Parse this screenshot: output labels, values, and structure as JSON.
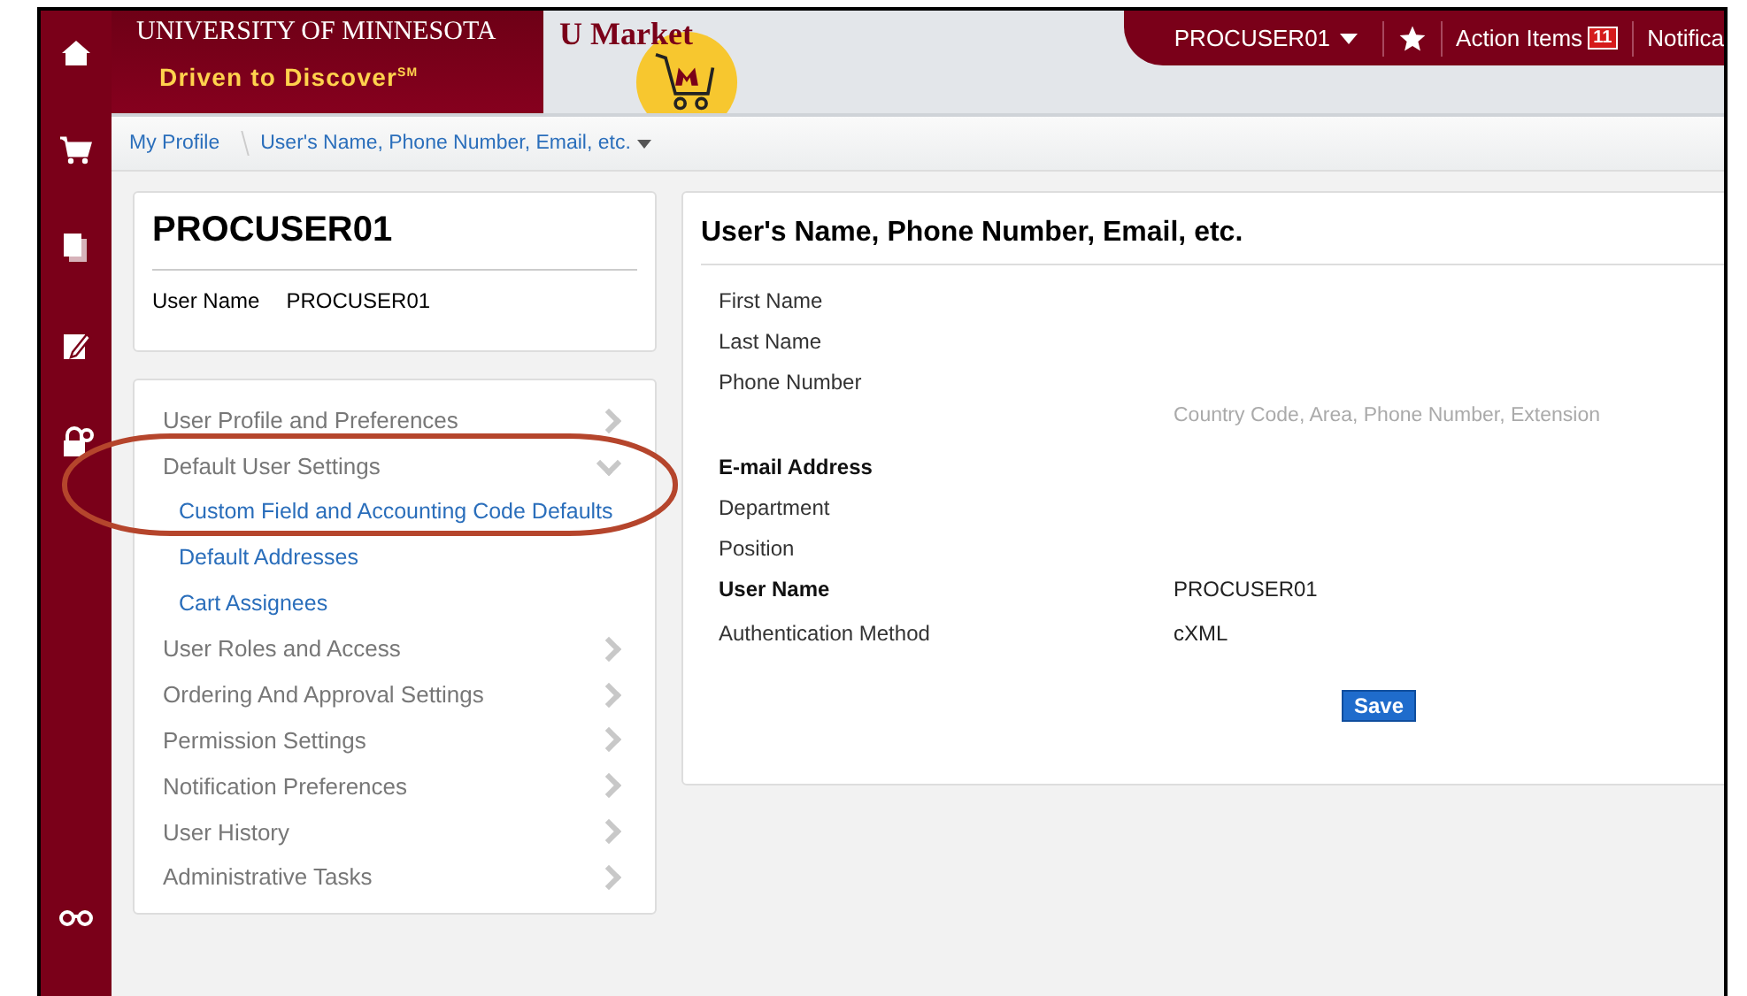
{
  "header": {
    "university": "UNIVERSITY OF MINNESOTA",
    "tagline": "Driven to Discover$^{SM}$",
    "app_name": "U Market",
    "user_menu": "PROCUSER01",
    "action_items": "Action Items",
    "action_count": "11",
    "notifications": "Notifica"
  },
  "breadcrumb": [
    {
      "label": "My Profile"
    },
    {
      "label": "User's Name, Phone Number, Email, etc."
    }
  ],
  "profile_card": {
    "title": "PROCUSER01",
    "user_name_label": "User Name",
    "user_name_value": "PROCUSER01"
  },
  "menu": [
    {
      "label": "User Profile and Preferences",
      "expanded": false
    },
    {
      "label": "Default User Settings",
      "expanded": true,
      "children": [
        {
          "label": "Custom Field and Accounting Code Defaults"
        },
        {
          "label": "Default Addresses"
        },
        {
          "label": "Cart Assignees"
        }
      ]
    },
    {
      "label": "User Roles and Access",
      "expanded": false
    },
    {
      "label": "Ordering And Approval Settings",
      "expanded": false
    },
    {
      "label": "Permission Settings",
      "expanded": false
    },
    {
      "label": "Notification Preferences",
      "expanded": false
    },
    {
      "label": "User History",
      "expanded": false
    },
    {
      "label": "Administrative Tasks",
      "expanded": false
    }
  ],
  "form": {
    "title": "User's Name, Phone Number, Email, etc.",
    "fields": [
      {
        "label": "First Name",
        "required": false
      },
      {
        "label": "Last Name",
        "required": false
      },
      {
        "label": "Phone Number",
        "required": false,
        "hint": "Country Code, Area, Phone Number, Extension"
      },
      {
        "label": "E-mail Address",
        "required": true
      },
      {
        "label": "Department",
        "required": false
      },
      {
        "label": "Position",
        "required": false
      },
      {
        "label": "User Name",
        "required": true,
        "value": "PROCUSER01"
      },
      {
        "label": "Authentication Method",
        "required": false,
        "value": "cXML"
      }
    ],
    "save_button": "Save"
  }
}
